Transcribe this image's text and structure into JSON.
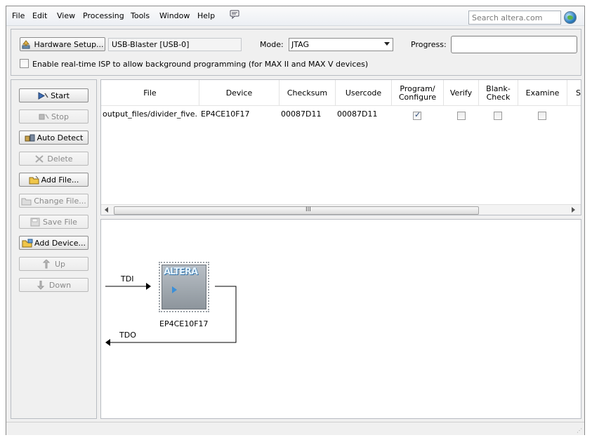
{
  "menu": {
    "items": [
      "File",
      "Edit",
      "View",
      "Processing",
      "Tools",
      "Window",
      "Help"
    ],
    "search_placeholder": "Search altera.com"
  },
  "top": {
    "hardware_setup_label": "Hardware Setup...",
    "hardware_value": "USB-Blaster [USB-0]",
    "mode_label": "Mode:",
    "mode_value": "JTAG",
    "progress_label": "Progress:",
    "isp_label": "Enable real-time ISP to allow background programming (for MAX II and MAX V devices)"
  },
  "sidebar": {
    "buttons": [
      {
        "label": "Start",
        "enabled": true
      },
      {
        "label": "Stop",
        "enabled": false
      },
      {
        "label": "Auto Detect",
        "enabled": true
      },
      {
        "label": "Delete",
        "enabled": false
      },
      {
        "label": "Add File...",
        "enabled": true
      },
      {
        "label": "Change File...",
        "enabled": false
      },
      {
        "label": "Save File",
        "enabled": false
      },
      {
        "label": "Add Device...",
        "enabled": true
      },
      {
        "label": "Up",
        "enabled": false
      },
      {
        "label": "Down",
        "enabled": false
      }
    ]
  },
  "table": {
    "columns": [
      "File",
      "Device",
      "Checksum",
      "Usercode",
      "Program/\nConfigure",
      "Verify",
      "Blank-\nCheck",
      "Examine",
      "S"
    ],
    "rows": [
      {
        "file": "output_files/divider_five....",
        "device": "EP4CE10F17",
        "checksum": "00087D11",
        "usercode": "00087D11",
        "program": true,
        "verify": false,
        "blank_check": false,
        "examine": false
      }
    ],
    "scroll_grip": "III"
  },
  "chain": {
    "tdi_label": "TDI",
    "tdo_label": "TDO",
    "device_label": "EP4CE10F17",
    "logo_text": "ALTERA"
  }
}
